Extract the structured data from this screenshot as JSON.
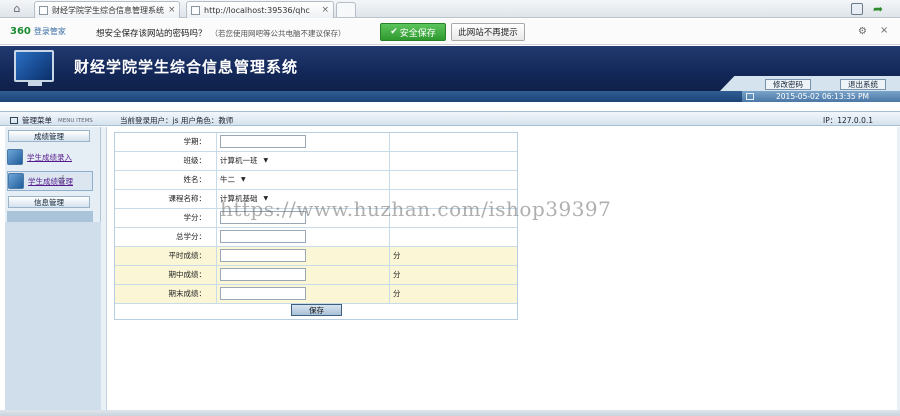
{
  "browser": {
    "tabs": [
      {
        "title": "财经学院学生综合信息管理系统",
        "close": "×"
      },
      {
        "title": "http://localhost:39536/qhc",
        "close": "×"
      }
    ],
    "icons": [
      "home-icon",
      "tab-favicon",
      "win-restore-icon",
      "back-arrow-icon"
    ]
  },
  "save_bar": {
    "brand": "360",
    "brand_sub": "登录管家",
    "question": "想安全保存该网站的密码吗？",
    "warning": "（若您使用网吧等公共电脑不建议保存）",
    "save_button": "安全保存",
    "no_prompt_button": "此网站不再提示",
    "gear": "⚙",
    "close": "×"
  },
  "header": {
    "title": "财经学院学生综合信息管理系统",
    "change_password": "修改密码",
    "logout": "退出系统"
  },
  "datetime": "2015-05-02 06:13:35 PM",
  "info_bar": {
    "menu_title": "管理菜单",
    "menu_sub": "MENU ITEMS",
    "current_user": "当前登录用户：js  用户角色：教师",
    "ip": "IP：127.0.0.1"
  },
  "sidebar": {
    "group1": "成绩管理",
    "item1": "学生成绩录入",
    "item2": "学生成绩管理",
    "group2": "信息管理"
  },
  "form": {
    "rows": [
      {
        "label": "学期：",
        "value": "",
        "extra": ""
      },
      {
        "label": "班级：",
        "value": "计算机一班",
        "extra": ""
      },
      {
        "label": "姓名：",
        "value": "牛二",
        "extra": ""
      },
      {
        "label": "课程名称：",
        "value": "计算机基础",
        "extra": ""
      },
      {
        "label": "学分：",
        "value": "",
        "extra": ""
      },
      {
        "label": "总学分：",
        "value": "",
        "extra": ""
      },
      {
        "label": "平时成绩：",
        "value": "",
        "extra": "分"
      },
      {
        "label": "期中成绩：",
        "value": "",
        "extra": "分"
      },
      {
        "label": "期末成绩：",
        "value": "",
        "extra": "分"
      }
    ],
    "submit": "保存"
  },
  "watermark": "https://www.huzhan.com/ishop39397"
}
